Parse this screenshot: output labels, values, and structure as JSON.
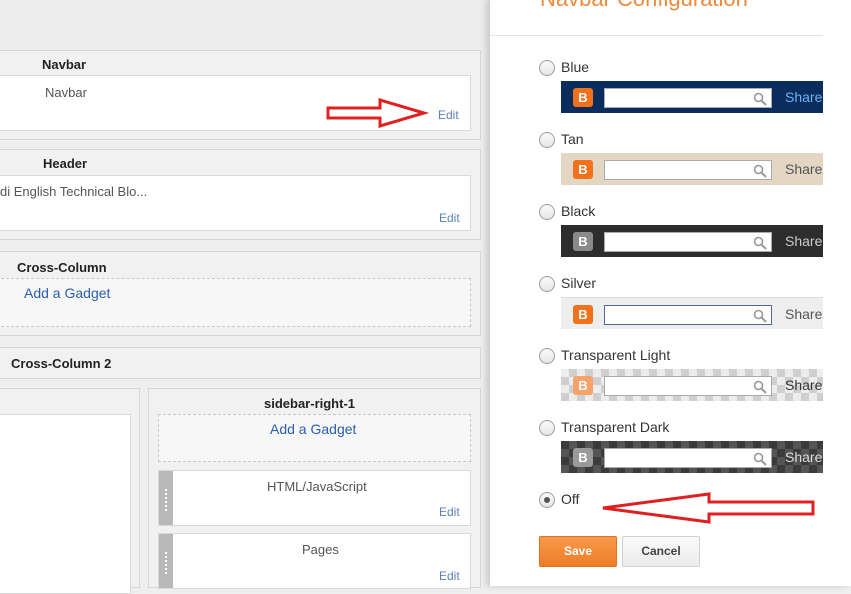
{
  "layout": {
    "navbar": {
      "title": "Navbar",
      "gadget_name": "Navbar",
      "edit": "Edit"
    },
    "header": {
      "title": "Header",
      "gadget_name": "di English Technical Blo...",
      "edit": "Edit"
    },
    "cross_column": {
      "title": "Cross-Column",
      "add_gadget": "Add a Gadget"
    },
    "cross_column_2": {
      "title": "Cross-Column 2"
    },
    "sidebar_right": {
      "title": "sidebar-right-1",
      "add_gadget": "Add a Gadget",
      "gadgets": [
        {
          "name": "HTML/JavaScript",
          "edit": "Edit"
        },
        {
          "name": "Pages",
          "edit": "Edit"
        }
      ]
    }
  },
  "dialog": {
    "title": "Navbar Configuration",
    "selected": "Off",
    "options": [
      {
        "label": "Blue",
        "bg": "#0b2d5e",
        "logo": "#f2711c",
        "share": "Share",
        "share_color": "#6fb0f0"
      },
      {
        "label": "Tan",
        "bg": "#e3d6c3",
        "logo": "#f2711c",
        "share": "Share",
        "share_color": "#555555"
      },
      {
        "label": "Black",
        "bg": "#2d2d2d",
        "logo": "#8a8a8a",
        "share": "Share",
        "share_color": "#cccccc"
      },
      {
        "label": "Silver",
        "bg": "#eeeeee",
        "logo": "#f2711c",
        "share": "Share",
        "share_color": "#555555"
      },
      {
        "label": "Transparent Light",
        "bg": "checker",
        "logo": "#f7a26a",
        "share": "Share",
        "share_color": "#333333"
      },
      {
        "label": "Transparent Dark",
        "bg": "checker-dark",
        "logo": "#9a9a9a",
        "share": "Share",
        "share_color": "#dddddd"
      }
    ],
    "off_label": "Off",
    "save": "Save",
    "cancel": "Cancel"
  },
  "colors": {
    "accent": "#ee7c26",
    "link": "#2a5db0",
    "annotation_arrow": "#e02020"
  }
}
